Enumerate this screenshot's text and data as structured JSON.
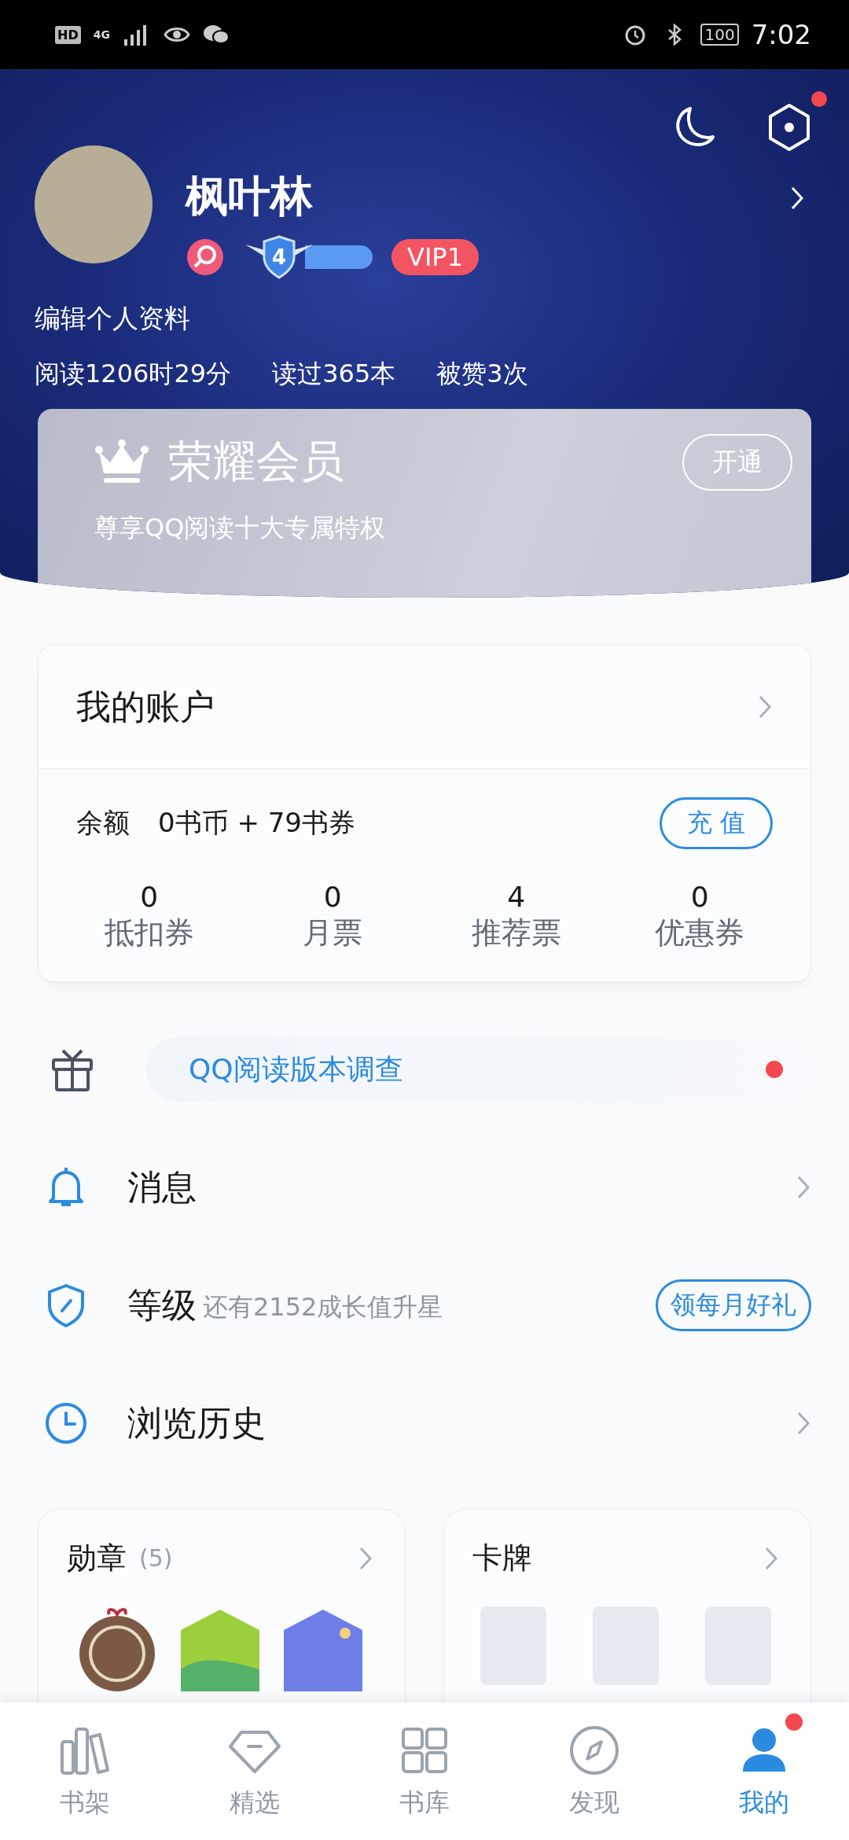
{
  "status_bar": {
    "hd": "HD",
    "network": "4G",
    "battery": "100",
    "time": "7:02"
  },
  "profile": {
    "name": "枫叶林",
    "level": "4",
    "vip": "VIP1",
    "edit": "编辑个人资料",
    "settings_dot": true,
    "stats": [
      "阅读1206时29分",
      "读过365本",
      "被赞3次"
    ]
  },
  "member": {
    "title": "荣耀会员",
    "subtitle": "尊享QQ阅读十大专属特权",
    "button": "开通"
  },
  "account": {
    "title": "我的账户",
    "balance_label": "余额",
    "balance": "0书币 + 79书券",
    "recharge": "充 值",
    "items": [
      {
        "value": "0",
        "label": "抵扣券"
      },
      {
        "value": "0",
        "label": "月票"
      },
      {
        "value": "4",
        "label": "推荐票"
      },
      {
        "value": "0",
        "label": "优惠券"
      }
    ]
  },
  "survey": {
    "text": "QQ阅读版本调查",
    "dot": true
  },
  "menu": [
    {
      "kind": "link",
      "label": "消息"
    },
    {
      "kind": "level",
      "label": "等级",
      "note": "还有2152成长值升星",
      "action": "领每月好礼"
    },
    {
      "kind": "link",
      "label": "浏览历史"
    }
  ],
  "cards": [
    {
      "kind": "badges",
      "title": "勋章",
      "count": "(5)"
    },
    {
      "kind": "cards",
      "title": "卡牌"
    }
  ],
  "tabs": [
    {
      "label": "书架",
      "selected": false,
      "dot": false
    },
    {
      "label": "精选",
      "selected": false,
      "dot": false
    },
    {
      "label": "书库",
      "selected": false,
      "dot": false
    },
    {
      "label": "发现",
      "selected": false,
      "dot": false
    },
    {
      "label": "我的",
      "selected": true,
      "dot": true
    }
  ]
}
